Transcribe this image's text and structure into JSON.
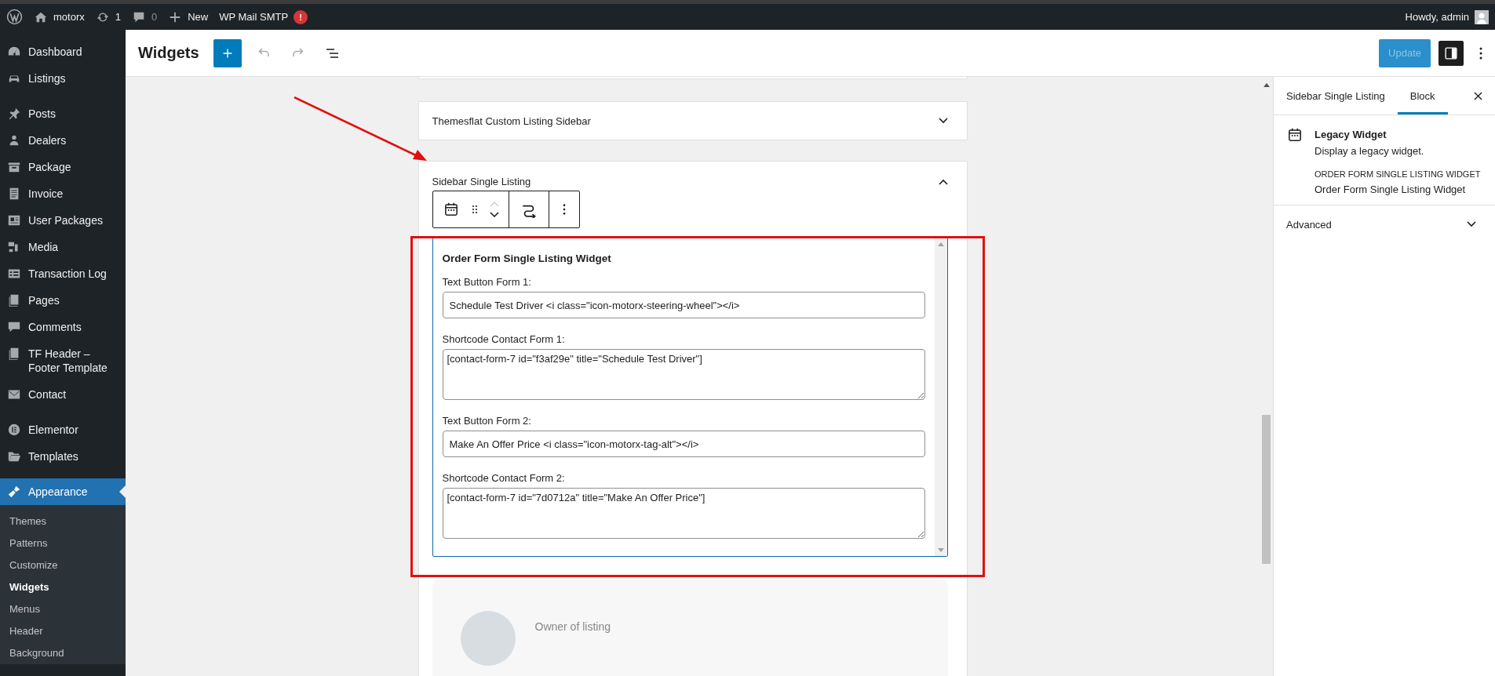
{
  "admin_bar": {
    "site": "motorx",
    "updates": "1",
    "comments": "0",
    "new": "New",
    "smtp": "WP Mail SMTP",
    "smtp_badge": "!",
    "greeting": "Howdy, admin"
  },
  "sidebar": {
    "groups": [
      {
        "items": [
          {
            "label": "Dashboard",
            "selected": false
          },
          {
            "label": "Listings",
            "selected": false
          }
        ]
      },
      {
        "items": [
          {
            "label": "Posts",
            "selected": false
          },
          {
            "label": "Dealers",
            "selected": false
          },
          {
            "label": "Package",
            "selected": false
          },
          {
            "label": "Invoice",
            "selected": false
          },
          {
            "label": "User Packages",
            "selected": false
          },
          {
            "label": "Media",
            "selected": false
          },
          {
            "label": "Transaction Log",
            "selected": false
          },
          {
            "label": "Pages",
            "selected": false
          },
          {
            "label": "Comments",
            "selected": false
          },
          {
            "label": "TF Header – Footer Template",
            "selected": false
          },
          {
            "label": "Contact",
            "selected": false
          }
        ]
      },
      {
        "items": [
          {
            "label": "Elementor",
            "selected": false
          },
          {
            "label": "Templates",
            "selected": false
          }
        ]
      },
      {
        "items": [
          {
            "label": "Appearance",
            "selected": true,
            "submenu": [
              {
                "label": "Themes",
                "selected": false
              },
              {
                "label": "Patterns",
                "selected": false
              },
              {
                "label": "Customize",
                "selected": false
              },
              {
                "label": "Widgets",
                "selected": true
              },
              {
                "label": "Menus",
                "selected": false
              },
              {
                "label": "Header",
                "selected": false
              },
              {
                "label": "Background",
                "selected": false
              }
            ]
          }
        ]
      }
    ]
  },
  "editor": {
    "title": "Widgets",
    "update": {
      "label": "Update",
      "disabled": true
    }
  },
  "widget_areas": [
    {
      "title": "Themesflat Custom Listing Sidebar",
      "expanded": false
    },
    {
      "title": "Sidebar Single Listing",
      "expanded": true
    }
  ],
  "widget": {
    "title": "Order Form Single Listing Widget",
    "fields": [
      {
        "kind": "input",
        "label": "Text Button Form 1:",
        "value": "Schedule Test Driver <i class=\"icon-motorx-steering-wheel\"></i>"
      },
      {
        "kind": "textarea",
        "label": "Shortcode Contact Form 1:",
        "value": "[contact-form-7 id=\"f3af29e\" title=\"Schedule Test Driver\"]"
      },
      {
        "kind": "input",
        "label": "Text Button Form 2:",
        "value": "Make An Offer Price <i class=\"icon-motorx-tag-alt\"></i>"
      },
      {
        "kind": "textarea",
        "label": "Shortcode Contact Form 2:",
        "value": "[contact-form-7 id=\"7d0712a\" title=\"Make An Offer Price\"]"
      }
    ]
  },
  "owner_card": {
    "label": "Owner of listing"
  },
  "inspector": {
    "tabs": [
      {
        "label": "Sidebar Single Listing",
        "selected": false
      },
      {
        "label": "Block",
        "selected": true
      }
    ],
    "block": {
      "name": "Legacy Widget",
      "description": "Display a legacy widget.",
      "widget_heading": "ORDER FORM SINGLE LISTING WIDGET",
      "widget_name": "Order Form Single Listing Widget"
    },
    "sections": [
      {
        "title": "Advanced",
        "expanded": false
      }
    ]
  }
}
